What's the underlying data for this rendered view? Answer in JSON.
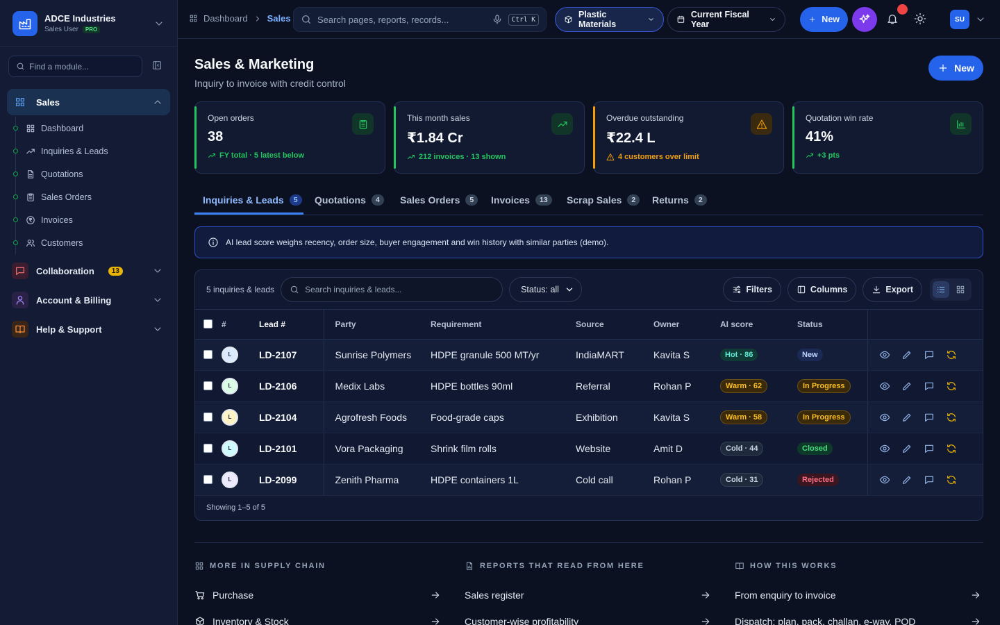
{
  "brand": {
    "name": "ADCE Industries",
    "role": "Sales User",
    "tier": "PRO"
  },
  "sidebar": {
    "find_placeholder": "Find a module...",
    "groups": [
      {
        "label": "Sales",
        "icon": "grid-icon",
        "expanded": true
      },
      {
        "label": "Collaboration",
        "icon": "chat-icon",
        "badge": "13"
      },
      {
        "label": "Account & Billing",
        "icon": "user-icon"
      },
      {
        "label": "Help & Support",
        "icon": "book-icon"
      }
    ],
    "sales_items": [
      {
        "label": "Dashboard",
        "icon": "grid-icon"
      },
      {
        "label": "Inquiries & Leads",
        "icon": "trend-icon"
      },
      {
        "label": "Quotations",
        "icon": "doc-icon"
      },
      {
        "label": "Sales Orders",
        "icon": "clipboard-icon"
      },
      {
        "label": "Invoices",
        "icon": "rupee-icon"
      },
      {
        "label": "Customers",
        "icon": "users-icon"
      }
    ]
  },
  "topbar": {
    "breadcrumb": [
      "Dashboard",
      "Sales"
    ],
    "search_placeholder": "Search pages, reports, records...",
    "shortcut": "Ctrl K",
    "org": "Plastic Materials",
    "period": "Current Fiscal Year",
    "new_label": "New",
    "user_initials": "SU"
  },
  "page": {
    "title": "Sales & Marketing",
    "subtitle": "Inquiry to invoice with credit control",
    "new_label": "New"
  },
  "kpis": [
    {
      "label": "Open orders",
      "value": "38",
      "foot": "FY total · 5 latest below",
      "accent": "#22c55e",
      "icon": "clipboard-icon"
    },
    {
      "label": "This month sales",
      "value": "₹1.84 Cr",
      "foot": "212 invoices · 13 shown",
      "accent": "#22c55e",
      "icon": "trend-up-icon"
    },
    {
      "label": "Overdue outstanding",
      "value": "₹22.4 L",
      "foot": "4 customers over limit",
      "accent": "#f59e0b",
      "icon": "warning-icon"
    },
    {
      "label": "Quotation win rate",
      "value": "41%",
      "foot": "+3 pts",
      "accent": "#22c55e",
      "icon": "bar-chart-icon"
    }
  ],
  "tabs": [
    {
      "label": "Inquiries & Leads",
      "count": "5"
    },
    {
      "label": "Quotations",
      "count": "4"
    },
    {
      "label": "Sales Orders",
      "count": "5"
    },
    {
      "label": "Invoices",
      "count": "13"
    },
    {
      "label": "Scrap Sales",
      "count": "2"
    },
    {
      "label": "Returns",
      "count": "2"
    }
  ],
  "info_text": "AI lead score weighs recency, order size, buyer engagement and win history with similar parties (demo).",
  "table": {
    "count_label": "5 inquiries & leads",
    "search_placeholder": "Search inquiries & leads...",
    "status_filter": "Status: all",
    "filters_label": "Filters",
    "columns_label": "Columns",
    "export_label": "Export",
    "headers": [
      "#",
      "Lead #",
      "Party",
      "Requirement",
      "Source",
      "Owner",
      "AI score",
      "Status"
    ],
    "rows": [
      {
        "initial": "L",
        "avatar_color": "#dbeafe",
        "lead": "LD-2107",
        "party": "Sunrise Polymers",
        "req": "HDPE granule 500 MT/yr",
        "source": "IndiaMART",
        "owner": "Kavita S",
        "score": "Hot · 86",
        "score_cls": "b-hot",
        "status": "New",
        "status_cls": "s-new"
      },
      {
        "initial": "L",
        "avatar_color": "#dcfce7",
        "lead": "LD-2106",
        "party": "Medix Labs",
        "req": "HDPE bottles 90ml",
        "source": "Referral",
        "owner": "Rohan P",
        "score": "Warm · 62",
        "score_cls": "b-warm",
        "status": "In Progress",
        "status_cls": "s-prog"
      },
      {
        "initial": "L",
        "avatar_color": "#fef3c7",
        "lead": "LD-2104",
        "party": "Agrofresh Foods",
        "req": "Food-grade caps",
        "source": "Exhibition",
        "owner": "Kavita S",
        "score": "Warm · 58",
        "score_cls": "b-warm",
        "status": "In Progress",
        "status_cls": "s-prog"
      },
      {
        "initial": "L",
        "avatar_color": "#cffafe",
        "lead": "LD-2101",
        "party": "Vora Packaging",
        "req": "Shrink film rolls",
        "source": "Website",
        "owner": "Amit D",
        "score": "Cold · 44",
        "score_cls": "b-cold",
        "status": "Closed",
        "status_cls": "s-closed"
      },
      {
        "initial": "L",
        "avatar_color": "#ede9fe",
        "lead": "LD-2099",
        "party": "Zenith Pharma",
        "req": "HDPE containers 1L",
        "source": "Cold call",
        "owner": "Rohan P",
        "score": "Cold · 31",
        "score_cls": "b-cold",
        "status": "Rejected",
        "status_cls": "s-rej"
      }
    ],
    "footer": "Showing 1–5 of 5"
  },
  "bottom": [
    {
      "heading": "MORE IN SUPPLY CHAIN",
      "icon": "grid-icon",
      "links": [
        {
          "label": "Purchase",
          "icon": "cart-icon"
        },
        {
          "label": "Inventory & Stock",
          "icon": "box-icon"
        }
      ]
    },
    {
      "heading": "REPORTS THAT READ FROM HERE",
      "icon": "report-icon",
      "links": [
        {
          "label": "Sales register"
        },
        {
          "label": "Customer-wise profitability"
        }
      ]
    },
    {
      "heading": "HOW THIS WORKS",
      "icon": "book-icon",
      "links": [
        {
          "label": "From enquiry to invoice"
        },
        {
          "label": "Dispatch: plan, pack, challan, e-way, POD"
        }
      ]
    }
  ]
}
